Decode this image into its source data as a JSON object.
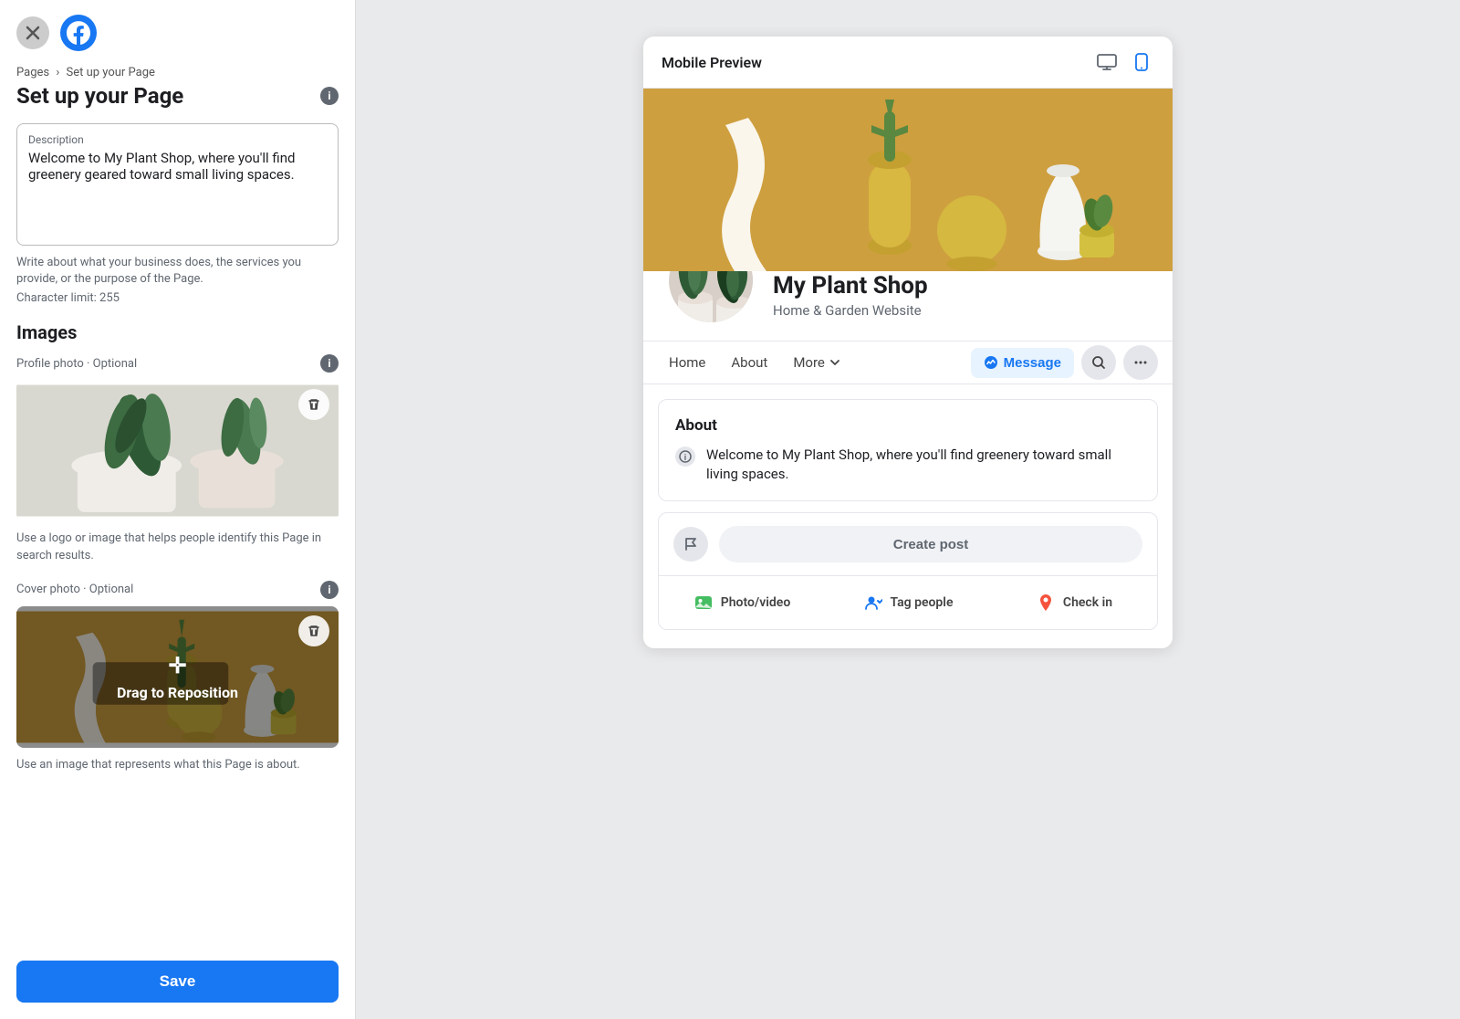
{
  "left": {
    "breadcrumb": {
      "pages": "Pages",
      "sep": "›",
      "current": "Set up your Page"
    },
    "title": "Set up your Page",
    "description": {
      "label": "Description",
      "value": "Welcome to My Plant Shop, where you'll find greenery geared toward small living spaces.",
      "helper": "Write about what your business does, the services you provide, or the purpose of the Page.",
      "char_limit": "Character limit: 255"
    },
    "images_title": "Images",
    "profile_photo": {
      "label": "Profile photo",
      "optional": "· Optional",
      "helper": "Use a logo or image that helps people identify this Page in search results."
    },
    "cover_photo": {
      "label": "Cover photo",
      "optional": "· Optional",
      "drag_text": "Drag to Reposition",
      "helper": "Use an image that represents what this Page is about."
    },
    "save_btn": "Save"
  },
  "preview": {
    "title": "Mobile Preview",
    "page_name": "My Plant Shop",
    "category": "Home & Garden Website",
    "nav_items": [
      "Home",
      "About",
      "More"
    ],
    "message_btn": "Message",
    "about_title": "About",
    "about_text": "Welcome to My Plant Shop, where you'll find greenery toward small living spaces.",
    "create_post_label": "Create post",
    "post_actions": [
      {
        "label": "Photo/video",
        "color": "#45bd62"
      },
      {
        "label": "Tag people",
        "color": "#1877f2"
      },
      {
        "label": "Check in",
        "color": "#f5533d"
      }
    ]
  },
  "colors": {
    "fb_blue": "#1877f2",
    "light_blue_bg": "#e7f3ff",
    "golden": "#c9973a",
    "green": "#45bd62",
    "red": "#f5533d"
  }
}
